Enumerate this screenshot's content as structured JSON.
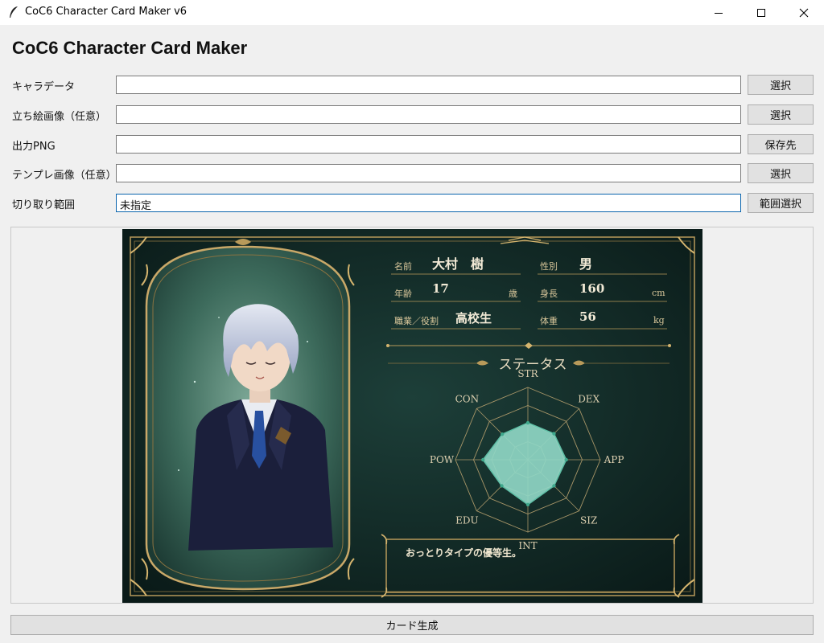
{
  "window": {
    "title": "CoC6 Character Card Maker v6"
  },
  "header": {
    "title": "CoC6 Character Card Maker"
  },
  "form": {
    "rows": [
      {
        "label": "キャラデータ",
        "value": "",
        "button": "選択"
      },
      {
        "label": "立ち絵画像（任意）",
        "value": "",
        "button": "選択"
      },
      {
        "label": "出力PNG",
        "value": "",
        "button": "保存先"
      },
      {
        "label": "テンプレ画像（任意）",
        "value": "",
        "button": "選択"
      },
      {
        "label": "切り取り範囲",
        "value": "未指定",
        "button": "範囲選択"
      }
    ]
  },
  "card": {
    "profile": {
      "name_label": "名前",
      "name_value": "大村　樹",
      "gender_label": "性別",
      "gender_value": "男",
      "age_label": "年齢",
      "age_value": "17",
      "age_unit": "歳",
      "height_label": "身長",
      "height_value": "160",
      "height_unit": "cm",
      "job_label": "職業／役割",
      "job_value": "高校生",
      "weight_label": "体重",
      "weight_value": "56",
      "weight_unit": "kg"
    },
    "status_heading": "ステータス",
    "memo": "おっとりタイプの優等生。",
    "colors": {
      "background": "#0f2422",
      "gold": "#b89a5a",
      "radar_fill": "#8fd6c4"
    }
  },
  "chart_data": {
    "type": "radar",
    "axes": [
      "STR",
      "DEX",
      "APP",
      "SIZ",
      "INT",
      "EDU",
      "POW",
      "CON"
    ],
    "rings": 4,
    "values": [
      0.51,
      0.51,
      0.53,
      0.51,
      0.62,
      0.51,
      0.62,
      0.5
    ]
  },
  "footer": {
    "generate_label": "カード生成"
  }
}
